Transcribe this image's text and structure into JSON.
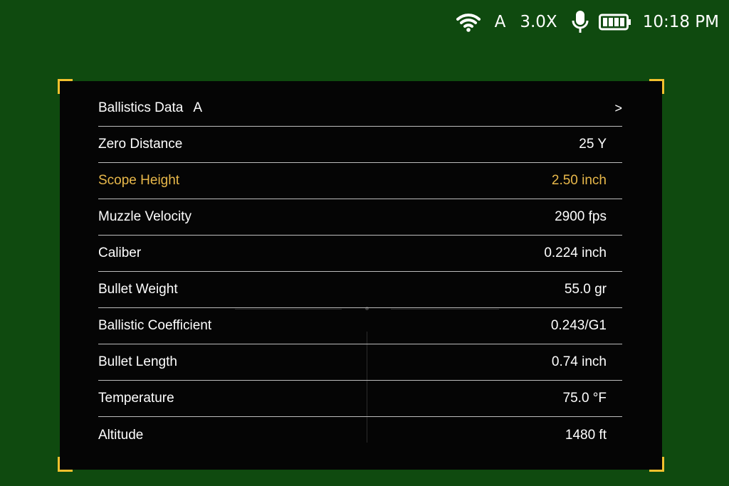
{
  "status_bar": {
    "mode": "A",
    "zoom": "3.0X",
    "time": "10:18 PM",
    "icons": [
      "wifi-icon",
      "microphone-icon",
      "battery-icon"
    ]
  },
  "panel": {
    "header": {
      "title": "Ballistics Data",
      "profile": "A",
      "arrow": ">"
    },
    "rows": [
      {
        "label": "Zero Distance",
        "value": "25 Y",
        "selected": false
      },
      {
        "label": "Scope Height",
        "value": "2.50 inch",
        "selected": true
      },
      {
        "label": "Muzzle Velocity",
        "value": "2900 fps",
        "selected": false
      },
      {
        "label": "Caliber",
        "value": "0.224 inch",
        "selected": false
      },
      {
        "label": "Bullet Weight",
        "value": "55.0 gr",
        "selected": false
      },
      {
        "label": "Ballistic Coefficient",
        "value": "0.243/G1",
        "selected": false
      },
      {
        "label": "Bullet Length",
        "value": "0.74 inch",
        "selected": false
      },
      {
        "label": "Temperature",
        "value": "75.0 °F",
        "selected": false
      },
      {
        "label": "Altitude",
        "value": "1480 ft",
        "selected": false
      }
    ]
  },
  "colors": {
    "background": "#0f4a0f",
    "panel": "#050505",
    "accent": "#f2c12e",
    "selected_text": "#e8b84a"
  }
}
